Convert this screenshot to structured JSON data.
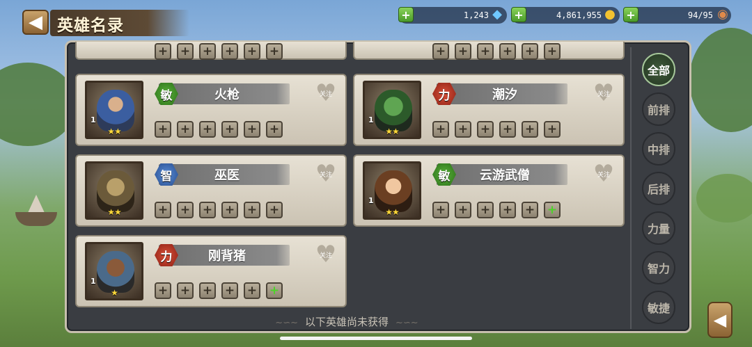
{
  "header": {
    "title": "英雄名录",
    "back_icon": "back-arrow-icon"
  },
  "resources": {
    "diamonds": "1,243",
    "gold": "4,861,955",
    "stamina": "94/95",
    "diamond_icon": "diamond-icon",
    "gold_icon": "gold-coins-icon",
    "stamina_icon": "meat-drumstick-icon"
  },
  "heroes": [
    {
      "name": "火枪",
      "attr": "敏",
      "level": "1",
      "stars": "★★",
      "follow": "关注"
    },
    {
      "name": "潮汐",
      "attr": "力",
      "level": "1",
      "stars": "★★",
      "follow": "关注"
    },
    {
      "name": "巫医",
      "attr": "智",
      "level": "",
      "stars": "★★",
      "follow": "关注"
    },
    {
      "name": "云游武僧",
      "attr": "敏",
      "level": "1",
      "stars": "★★",
      "follow": "关注"
    },
    {
      "name": "刚背猪",
      "attr": "力",
      "level": "1",
      "stars": "★",
      "follow": "关注"
    }
  ],
  "sidebar": {
    "filters": [
      "全部",
      "前排",
      "中排",
      "后排",
      "力量",
      "智力",
      "敏捷"
    ],
    "selected": "全部"
  },
  "notice": "以下英雄尚未获得",
  "colors": {
    "agility": "#3a8f24",
    "strength": "#b02a18",
    "intelligence": "#3a68b0",
    "equip_available": "#4dd22a"
  }
}
